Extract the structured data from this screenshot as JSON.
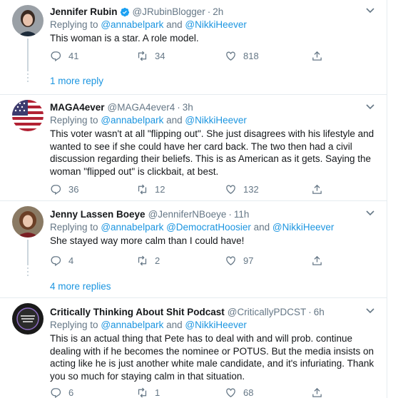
{
  "colors": {
    "accent": "#1b95e0",
    "muted": "#657786",
    "text": "#14171a",
    "border": "#e6ecf0"
  },
  "replying_to_label": "Replying to",
  "and_label": "and",
  "tweets": [
    {
      "name": "Jennifer Rubin",
      "verified": true,
      "handle": "@JRubinBlogger",
      "dot": "·",
      "time": "2h",
      "mentions": [
        "@annabelpark",
        "@NikkiHeever"
      ],
      "text": "This woman is a star. A role model.",
      "replies": "41",
      "retweets": "34",
      "likes": "818",
      "avatar_icon": "profile-photo"
    },
    {
      "name": "MAGA4ever",
      "verified": false,
      "handle": "@MAGA4ever4",
      "dot": "·",
      "time": "3h",
      "mentions": [
        "@annabelpark",
        "@NikkiHeever"
      ],
      "text": "This voter wasn't at all \"flipping out\". She just disagrees with his lifestyle and wanted to see if she  could have her card back. The two then had a civil discussion regarding their beliefs. This is as American as it gets. Saying the woman \"flipped out\" is clickbait, at best.",
      "replies": "36",
      "retweets": "12",
      "likes": "132",
      "avatar_icon": "american-flag"
    },
    {
      "name": "Jenny Lassen Boeye",
      "verified": false,
      "handle": "@JenniferNBoeye",
      "dot": "·",
      "time": "11h",
      "mentions": [
        "@annabelpark",
        "@DemocratHoosier",
        "@NikkiHeever"
      ],
      "text": "She stayed way more calm than I could have!",
      "replies": "4",
      "retweets": "2",
      "likes": "97",
      "avatar_icon": "profile-photo"
    },
    {
      "name": "Critically Thinking About Shit Podcast",
      "verified": false,
      "handle": "@CriticallyPDCST",
      "dot": "·",
      "time": "6h",
      "mentions": [
        "@annabelpark",
        "@NikkiHeever"
      ],
      "text": "This is an actual thing that Pete has to deal with and will prob. continue dealing with if he becomes the nominee or POTUS. But the media insists on acting like he is just another white male candidate, and it's infuriating. Thank you so much for staying calm in that situation.",
      "replies": "6",
      "retweets": "1",
      "likes": "68",
      "avatar_icon": "podcast-logo"
    }
  ],
  "more_replies": [
    "1 more reply",
    "4 more replies"
  ]
}
